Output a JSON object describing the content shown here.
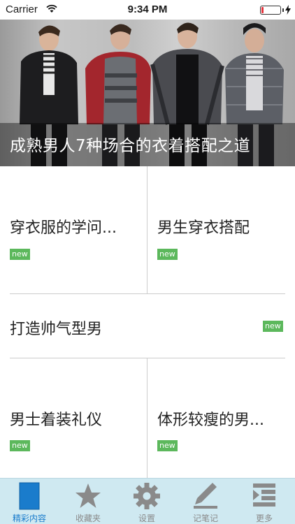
{
  "status_bar": {
    "carrier": "Carrier",
    "time": "9:34 PM",
    "battery_level": 0.12,
    "battery_color": "#e5323b"
  },
  "hero": {
    "caption": "成熟男人7种场合的衣着搭配之道"
  },
  "articles": [
    {
      "title": "穿衣服的学问...",
      "badge": "new"
    },
    {
      "title": "男生穿衣搭配",
      "badge": "new"
    },
    {
      "title": "打造帅气型男",
      "badge": "new"
    },
    {
      "title": "男士着装礼仪",
      "badge": "new"
    },
    {
      "title": "体形较瘦的男...",
      "badge": "new"
    }
  ],
  "tabs": [
    {
      "label": "精彩内容",
      "icon": "document-icon",
      "active": true
    },
    {
      "label": "收藏夹",
      "icon": "star-icon",
      "active": false
    },
    {
      "label": "设置",
      "icon": "gear-icon",
      "active": false
    },
    {
      "label": "记笔记",
      "icon": "pen-icon",
      "active": false
    },
    {
      "label": "更多",
      "icon": "more-list-icon",
      "active": false
    }
  ],
  "colors": {
    "accent": "#1a7ccc",
    "badge": "#5cb85c",
    "tab_bar": "#cfe9f1"
  }
}
